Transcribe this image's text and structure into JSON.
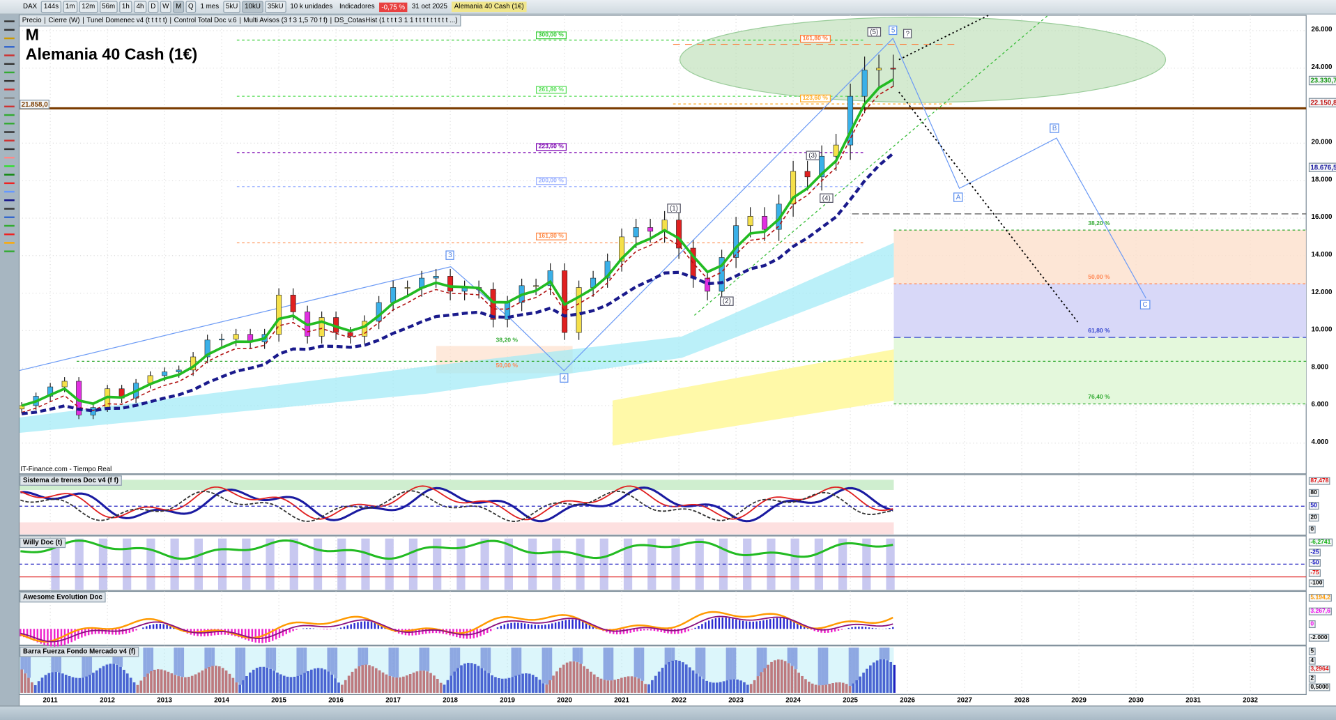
{
  "toolbar": {
    "symbol": "DAX",
    "timeframes": [
      "144s",
      "1m",
      "12m",
      "56m",
      "1h",
      "4h",
      "D",
      "W",
      "M",
      "Q"
    ],
    "active_timeframe": "M",
    "period": "1 mes",
    "units": [
      "5kU",
      "10kU",
      "35kU"
    ],
    "active_unit": "10kU",
    "units_select": "10 k unidades",
    "indicators": "Indicadores",
    "change": "-0,75 %",
    "date": "31 oct 2025",
    "instrument": "Alemania 40 Cash (1€)"
  },
  "indicator_bar": [
    "Precio",
    "Cierre (W)",
    "Tunel Domenec v4 (t t t t t)",
    "Control Total Doc v.6",
    "Multi Avisos (3 f 3 1,5 70 f f)",
    "DS_CotasHist (1 t t t 3 1 1 t t t t t t t t t ...)"
  ],
  "header": {
    "period": "M",
    "name": "Alemania 40 Cash (1€)"
  },
  "source": "IT-Finance.com - Tiempo Real",
  "left_price_label": "21.858,0",
  "colors": {
    "up": "#3ab0e8",
    "down": "#e02020",
    "ma_fast": "#22bb22",
    "ma_slow": "#1a1a8c",
    "support": "#7a3c00"
  },
  "chart_data": {
    "type": "candlestick",
    "x": [
      2010.5,
      2010.75,
      2011,
      2011.25,
      2011.5,
      2011.75,
      2012,
      2012.25,
      2012.5,
      2012.75,
      2013,
      2013.25,
      2013.5,
      2013.75,
      2014,
      2014.25,
      2014.5,
      2014.75,
      2015,
      2015.25,
      2015.5,
      2015.75,
      2016,
      2016.25,
      2016.5,
      2016.75,
      2017,
      2017.25,
      2017.5,
      2017.75,
      2018,
      2018.25,
      2018.5,
      2018.75,
      2019,
      2019.25,
      2019.5,
      2019.75,
      2020,
      2020.25,
      2020.5,
      2020.75,
      2021,
      2021.25,
      2021.5,
      2021.75,
      2022,
      2022.25,
      2022.5,
      2022.75,
      2023,
      2023.25,
      2023.5,
      2023.75,
      2024,
      2024.25,
      2024.5,
      2024.75,
      2025,
      2025.25,
      2025.5,
      2025.75
    ],
    "close": [
      6000,
      6500,
      7000,
      7300,
      5500,
      5900,
      6900,
      6400,
      7200,
      7600,
      7800,
      7900,
      8600,
      9500,
      9550,
      9800,
      9400,
      9800,
      11900,
      11000,
      9700,
      10700,
      9900,
      9700,
      10500,
      11500,
      12300,
      12300,
      12800,
      12900,
      12100,
      12300,
      12200,
      10600,
      11500,
      12400,
      12400,
      13200,
      9900,
      12300,
      12800,
      13700,
      15000,
      15500,
      15300,
      15900,
      14400,
      12800,
      12100,
      13900,
      15600,
      16100,
      15400,
      16750,
      18500,
      18200,
      19300,
      19900,
      22500,
      23900,
      24000,
      23950
    ],
    "y_ticks": [
      "26.000",
      "24.000",
      "20.000",
      "18.000",
      "16.000",
      "14.000",
      "12.000",
      "10.000",
      "8.000",
      "6.000",
      "4.000"
    ],
    "y_tick_values": [
      26000,
      24000,
      20000,
      18000,
      16000,
      14000,
      12000,
      10000,
      8000,
      6000,
      4000
    ],
    "price_markers": [
      {
        "label": "23.330,7",
        "value": 23330.7,
        "color": "#1a9a1a"
      },
      {
        "label": "22.150,8",
        "value": 22150.8,
        "color": "#c01010"
      },
      {
        "label": "18.676,5",
        "value": 18676.5,
        "color": "#1a1aa0"
      }
    ],
    "x_ticks": [
      "2011",
      "2012",
      "2013",
      "2014",
      "2015",
      "2016",
      "2017",
      "2018",
      "2019",
      "2020",
      "2021",
      "2022",
      "2023",
      "2024",
      "2025",
      "2026",
      "2027",
      "2028",
      "2029",
      "2030",
      "2031",
      "2032"
    ],
    "support_level": 21858,
    "fib_left": [
      {
        "label": "300,00 %",
        "color": "#33cc33"
      },
      {
        "label": "261,80 %",
        "color": "#55dd55"
      },
      {
        "label": "223,60 %",
        "color": "#7a00b0"
      },
      {
        "label": "200,00 %",
        "color": "#9ab0ff"
      },
      {
        "label": "161,80 %",
        "color": "#ff8844"
      }
    ],
    "fib_top": [
      {
        "label": "161,80 %",
        "color": "#ff7733"
      },
      {
        "label": "123,60 %",
        "color": "#ffaa22"
      }
    ],
    "fib_small": [
      {
        "label": "38,20 %",
        "color": "#33aa33"
      },
      {
        "label": "50,00 %",
        "color": "#ff8855"
      }
    ],
    "fib_right": [
      {
        "label": "38,20 %",
        "color": "#33aa33"
      },
      {
        "label": "50,00 %",
        "color": "#ff8855"
      },
      {
        "label": "61,80 %",
        "color": "#3344cc"
      },
      {
        "label": "76,40 %",
        "color": "#33aa33"
      }
    ],
    "waves": [
      "(5)",
      "5",
      "?",
      "(3)",
      "(1)",
      "(4)",
      "(2)",
      "3",
      "4",
      "A",
      "B",
      "C"
    ]
  },
  "panes": [
    {
      "title": "Sistema de trenes Doc v4 (f f)",
      "axis": [
        {
          "t": "87,478",
          "c": "#e01010"
        },
        {
          "t": "80",
          "c": "#000"
        },
        {
          "t": "50",
          "c": "#1010c0"
        },
        {
          "t": "20",
          "c": "#000"
        },
        {
          "t": "0",
          "c": "#000"
        }
      ]
    },
    {
      "title": "Willy Doc (t)",
      "axis": [
        {
          "t": "-6,2741",
          "c": "#10b010"
        },
        {
          "t": "-25",
          "c": "#1010c0"
        },
        {
          "t": "-50",
          "c": "#1010c0"
        },
        {
          "t": "-75",
          "c": "#e01010"
        },
        {
          "t": "-100",
          "c": "#000"
        }
      ]
    },
    {
      "title": "Awesome Evolution Doc",
      "axis": [
        {
          "t": "5.194,2",
          "c": "#ff9900"
        },
        {
          "t": "3.267,6",
          "c": "#ee00ee"
        },
        {
          "t": "0",
          "c": "#ee00ee"
        },
        {
          "t": "-2.000",
          "c": "#000"
        }
      ]
    },
    {
      "title": "Barra Fuerza Fondo Mercado v4 (f)",
      "axis": [
        {
          "t": "5",
          "c": "#000"
        },
        {
          "t": "4",
          "c": "#000"
        },
        {
          "t": "3,2964",
          "c": "#e01010"
        },
        {
          "t": "2",
          "c": "#000"
        },
        {
          "t": "0,5000",
          "c": "#000"
        }
      ]
    }
  ]
}
